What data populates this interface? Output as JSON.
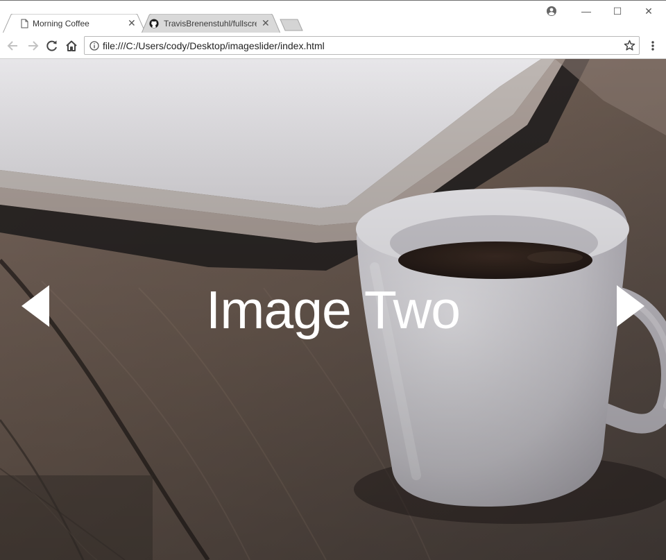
{
  "browser": {
    "tabs": [
      {
        "title": "Morning Coffee",
        "active": true,
        "icon": "page-icon"
      },
      {
        "title": "TravisBrenenstuhl/fullscre",
        "active": false,
        "icon": "github-icon"
      }
    ],
    "address_bar": {
      "url": "file:///C:/Users/cody/Desktop/imageslider/index.html"
    },
    "window_controls": {
      "minimize": "—",
      "maximize": "☐",
      "close": "✕"
    }
  },
  "slider": {
    "caption": "Image Two",
    "prev_icon": "left-triangle-icon",
    "next_icon": "right-triangle-icon"
  },
  "colors": {
    "caption": "#ffffff",
    "tab_active": "#ffffff",
    "tab_inactive": "#d9d9d9"
  }
}
